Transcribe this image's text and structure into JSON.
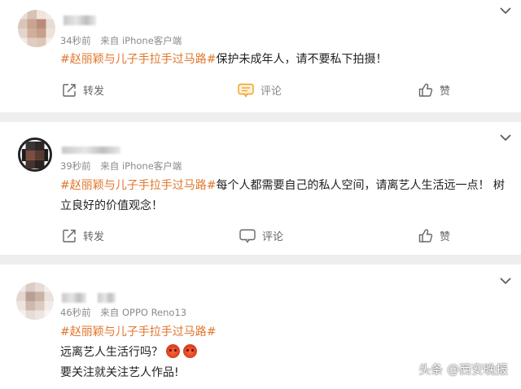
{
  "comments": [
    {
      "time": "34秒前",
      "source": "来自 iPhone客户端",
      "hashtag": "#赵丽颖与儿子手拉手过马路#",
      "text": "保护未成年人，请不要私下拍摄！",
      "actions": {
        "repost": "转发",
        "comment": "评论",
        "like": "赞"
      }
    },
    {
      "time": "39秒前",
      "source": "来自 iPhone客户端",
      "hashtag": "#赵丽颖与儿子手拉手过马路#",
      "text": "每个人都需要自己的私人空间，请离艺人生活远一点！ 树立良好的价值观念！",
      "actions": {
        "repost": "转发",
        "comment": "评论",
        "like": "赞"
      }
    },
    {
      "time": "46秒前",
      "source": "来自 OPPO Reno13",
      "hashtag": "#赵丽颖与儿子手拉手过马路#",
      "line1": "远离艺人生活行吗？",
      "line2": "要关注就关注艺人作品!"
    }
  ],
  "watermark": "头条 @西安晚报",
  "icons": {
    "expand": "chevron-down-icon",
    "repost": "share-icon",
    "comment": "comment-icon",
    "like": "thumbs-up-icon",
    "emoji": "angry-face-icon"
  },
  "colors": {
    "hashtag": "#e0762c",
    "text": "#222222",
    "meta": "#8a8a8a",
    "separator": "#eeeeee"
  }
}
